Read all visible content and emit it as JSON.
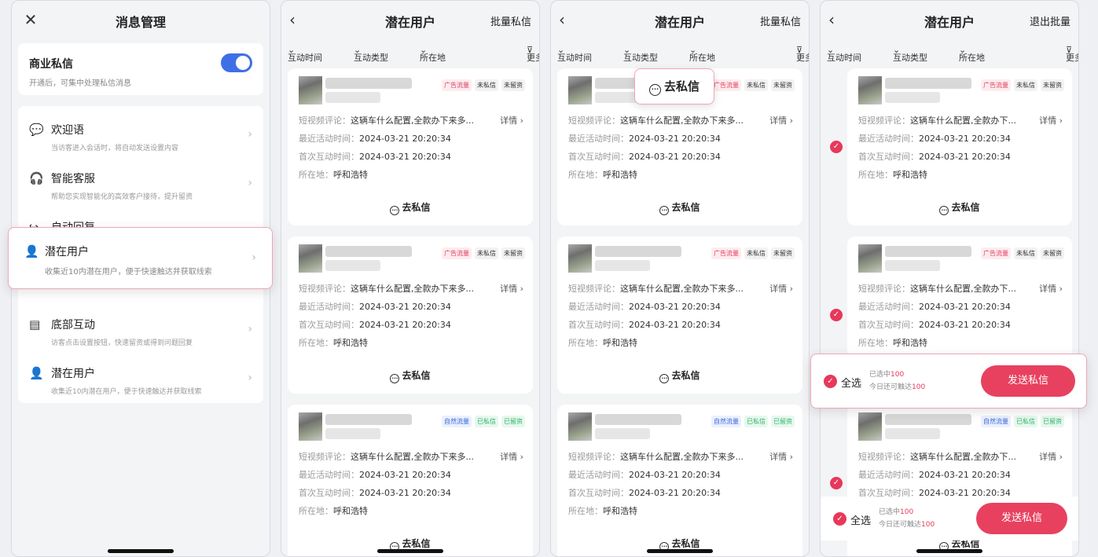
{
  "screen1": {
    "title": "消息管理",
    "business_msg": {
      "title": "商业私信",
      "desc": "开通后，可集中处理私信消息",
      "enabled": true
    },
    "menu": [
      {
        "icon": "chat-icon",
        "title": "欢迎语",
        "desc": "当访客进入会话时，将自动发送设置内容"
      },
      {
        "icon": "headset-icon",
        "title": "智能客服",
        "desc": "帮助您实现智能化的高效客户接待，提升留资"
      },
      {
        "icon": "auto-reply-icon",
        "title": "自动回复",
        "desc": ""
      },
      {
        "icon": "bottom-interact-icon",
        "title": "底部互动",
        "desc": "访客点击设置按钮，快速留资或得到问题回复"
      },
      {
        "icon": "users-icon",
        "title": "潜在用户",
        "desc": "收集近10内潜在用户，便于快速触达并获取线索"
      }
    ],
    "highlight": {
      "title": "潜在用户",
      "desc": "收集近10内潜在用户，便于快速触达并获取线索"
    }
  },
  "list": {
    "title": "潜在用户",
    "action_batch": "批量私信",
    "action_exit": "退出批量",
    "filters": [
      "互动时间",
      "互动类型",
      "所在地",
      "更多筛选"
    ],
    "row_labels": {
      "comment": "短视频评论：",
      "recent": "最近活动时间：",
      "first": "首次互动时间：",
      "location": "所在地："
    },
    "detail": "详情",
    "go_label": "去私信",
    "truncated_ellipsis": "...",
    "cards": [
      {
        "tags": [
          "广告流量",
          "未私信",
          "未留资"
        ],
        "tag_kinds": [
          "ad",
          "plain",
          "plain"
        ],
        "comment": "这辆车什么配置,全款办下来多...",
        "recent": "2024-03-21  20:20:34",
        "first": "2024-03-21  20:20:34",
        "location": "呼和浩特"
      },
      {
        "tags": [
          "广告流量",
          "未私信",
          "未留资"
        ],
        "tag_kinds": [
          "ad",
          "plain",
          "plain"
        ],
        "comment": "这辆车什么配置,全款办下来多...",
        "recent": "2024-03-21  20:20:34",
        "first": "2024-03-21  20:20:34",
        "location": "呼和浩特"
      },
      {
        "tags": [
          "自然流量",
          "已私信",
          "已留资"
        ],
        "tag_kinds": [
          "nat",
          "ok",
          "ok"
        ],
        "comment": "这辆车什么配置,全款办下来多...",
        "recent": "2024-03-21  20:20:34",
        "first": "2024-03-21  20:20:34",
        "location": "呼和浩特"
      }
    ],
    "cards_narrow": {
      "comment": "这辆车什么配置,全款办下..."
    }
  },
  "bubble": {
    "label": "去私信"
  },
  "bulk": {
    "select_all": "全选",
    "selected_prefix": "已选中",
    "selected_count": "100",
    "reach_prefix": "今日还可触达",
    "reach_count": "100",
    "send": "发送私信"
  },
  "colors": {
    "accent": "#e8415f",
    "toggle": "#3f6fe6"
  }
}
